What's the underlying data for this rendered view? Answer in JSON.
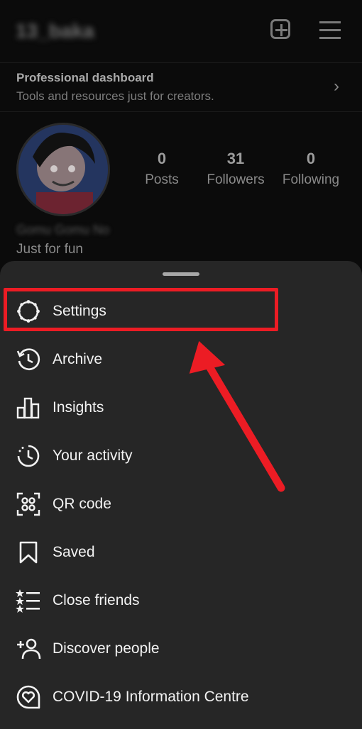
{
  "profile": {
    "username": "13_baka",
    "dashboard_title": "Professional dashboard",
    "dashboard_subtitle": "Tools and resources just for creators.",
    "stats": [
      {
        "value": "0",
        "label": "Posts"
      },
      {
        "value": "31",
        "label": "Followers"
      },
      {
        "value": "0",
        "label": "Following"
      }
    ],
    "display_name": "Gomu Gomu No",
    "bio": "Just for fun"
  },
  "icons": {
    "new_post": "plus-square-icon",
    "menu": "hamburger-icon",
    "dashboard_chevron": "chevron-right-icon"
  },
  "menu": {
    "items": [
      {
        "label": "Settings",
        "icon": "gear-icon"
      },
      {
        "label": "Archive",
        "icon": "archive-clock-icon"
      },
      {
        "label": "Insights",
        "icon": "bar-chart-icon"
      },
      {
        "label": "Your activity",
        "icon": "activity-clock-icon"
      },
      {
        "label": "QR code",
        "icon": "qr-code-icon"
      },
      {
        "label": "Saved",
        "icon": "bookmark-icon"
      },
      {
        "label": "Close friends",
        "icon": "star-list-icon"
      },
      {
        "label": "Discover people",
        "icon": "add-person-icon"
      },
      {
        "label": "COVID-19 Information Centre",
        "icon": "info-heart-icon"
      }
    ]
  },
  "colors": {
    "sheet_background": "#262626",
    "highlight": "#ec1c24",
    "text": "#f2f2f2"
  }
}
